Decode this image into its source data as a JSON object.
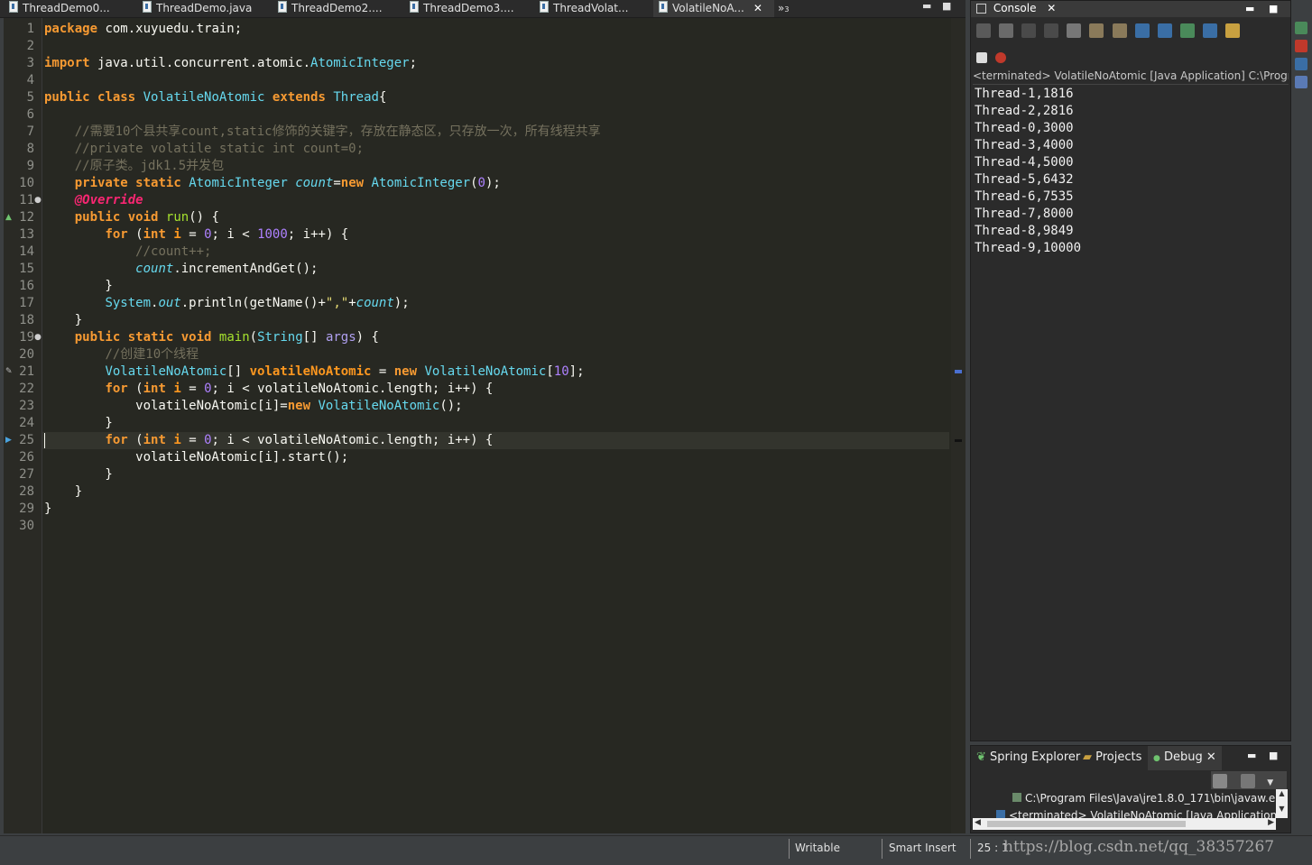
{
  "editor_tabs": [
    {
      "label": "ThreadDemo0...",
      "active": false
    },
    {
      "label": "ThreadDemo.java",
      "active": false
    },
    {
      "label": "ThreadDemo2....",
      "active": false
    },
    {
      "label": "ThreadDemo3....",
      "active": false
    },
    {
      "label": "ThreadVolat...",
      "active": false
    },
    {
      "label": "VolatileNoA...",
      "active": true
    }
  ],
  "overflow_tabs_label": "»",
  "overflow_tabs_count": "3",
  "window_controls": {
    "minimize": "▬",
    "maximize": "■"
  },
  "code": {
    "current_line": 25,
    "lines": [
      {
        "n": "1",
        "text": "package com.xuyuedu.train;"
      },
      {
        "n": "2",
        "text": ""
      },
      {
        "n": "3",
        "text": "import java.util.concurrent.atomic.AtomicInteger;"
      },
      {
        "n": "4",
        "text": ""
      },
      {
        "n": "5",
        "text": "public class VolatileNoAtomic extends Thread{"
      },
      {
        "n": "6",
        "text": ""
      },
      {
        "n": "7",
        "text": "    //需要10个县共享count,static修饰的关键字，存放在静态区，只存放一次，所有线程共享"
      },
      {
        "n": "8",
        "text": "    //private volatile static int count=0;"
      },
      {
        "n": "9",
        "text": "    //原子类。jdk1.5并发包"
      },
      {
        "n": "10",
        "text": "    private static AtomicInteger count=new AtomicInteger(0);"
      },
      {
        "n": "11",
        "text": "    @Override"
      },
      {
        "n": "12",
        "text": "    public void run() {"
      },
      {
        "n": "13",
        "text": "        for (int i = 0; i < 1000; i++) {"
      },
      {
        "n": "14",
        "text": "            //count++;"
      },
      {
        "n": "15",
        "text": "            count.incrementAndGet();"
      },
      {
        "n": "16",
        "text": "        }"
      },
      {
        "n": "17",
        "text": "        System.out.println(getName()+\",\"+count);"
      },
      {
        "n": "18",
        "text": "    }"
      },
      {
        "n": "19",
        "text": "    public static void main(String[] args) {"
      },
      {
        "n": "20",
        "text": "        //创建10个线程"
      },
      {
        "n": "21",
        "text": "        VolatileNoAtomic[] volatileNoAtomic = new VolatileNoAtomic[10];"
      },
      {
        "n": "22",
        "text": "        for (int i = 0; i < volatileNoAtomic.length; i++) {"
      },
      {
        "n": "23",
        "text": "            volatileNoAtomic[i]=new VolatileNoAtomic();"
      },
      {
        "n": "24",
        "text": "        }"
      },
      {
        "n": "25",
        "text": "        for (int i = 0; i < volatileNoAtomic.length; i++) {"
      },
      {
        "n": "26",
        "text": "            volatileNoAtomic[i].start();"
      },
      {
        "n": "27",
        "text": "        }"
      },
      {
        "n": "28",
        "text": "    }"
      },
      {
        "n": "29",
        "text": "}"
      },
      {
        "n": "30",
        "text": ""
      }
    ]
  },
  "console": {
    "title": "Console",
    "terminated_label": "<terminated> VolatileNoAtomic [Java Application] C:\\Progra",
    "output": [
      "Thread-1,1816",
      "Thread-2,2816",
      "Thread-0,3000",
      "Thread-3,4000",
      "Thread-4,5000",
      "Thread-5,6432",
      "Thread-6,7535",
      "Thread-7,8000",
      "Thread-8,9849",
      "Thread-9,10000"
    ]
  },
  "bottom_panel": {
    "tabs": [
      {
        "label": "Spring Explorer",
        "active": false
      },
      {
        "label": "Projects",
        "active": false
      },
      {
        "label": "Debug",
        "active": true
      }
    ],
    "rows": [
      "C:\\Program Files\\Java\\jre1.8.0_171\\bin\\javaw.e",
      "<terminated> VolatileNoAtomic [Java Application]"
    ]
  },
  "status_bar": {
    "writable": "Writable",
    "insert_mode": "Smart Insert",
    "position": "25 : 1",
    "watermark": "https://blog.csdn.net/qq_38357267"
  },
  "colors": {
    "editor_bg": "#272822",
    "keyword": "#f79a32",
    "type": "#66d9ef",
    "comment": "#75715e",
    "number": "#ae81ff",
    "method": "#a6e22e"
  }
}
